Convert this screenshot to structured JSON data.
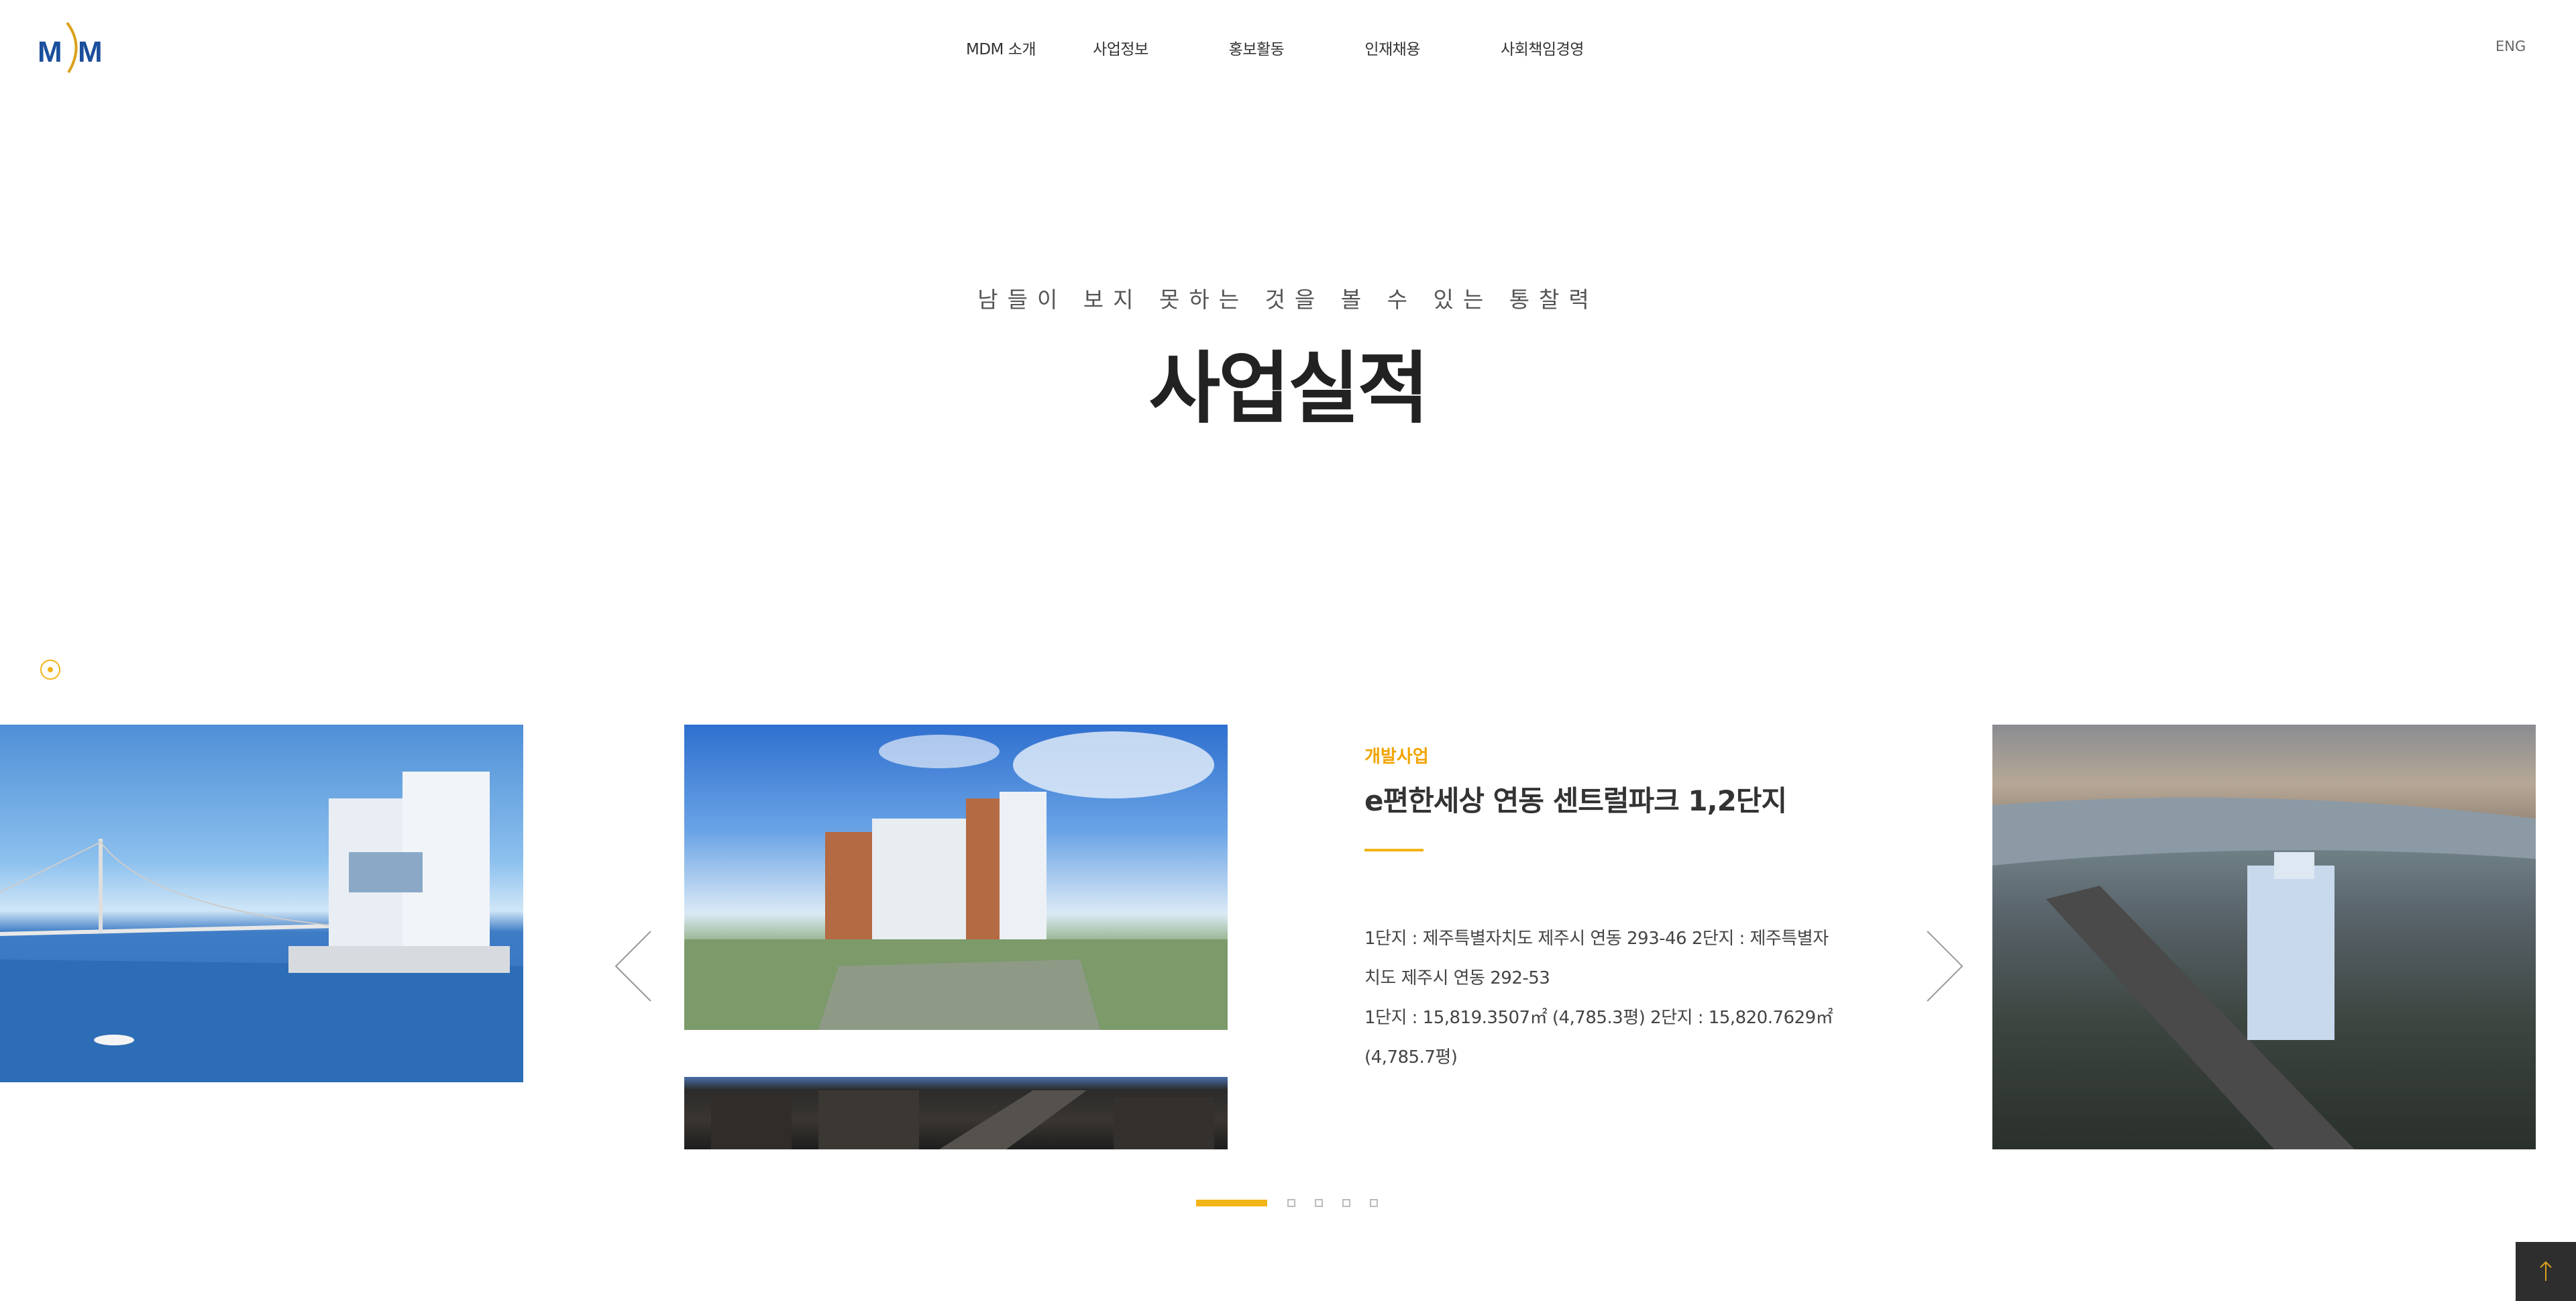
{
  "header": {
    "logo_text": "MDM",
    "nav": [
      "MDM 소개",
      "사업정보",
      "홍보활동",
      "인재채용",
      "사회책임경영"
    ],
    "lang": "ENG"
  },
  "hero": {
    "tagline": "남들이 보지 못하는 것을 볼 수 있는 통찰력",
    "title": "사업실적"
  },
  "slide": {
    "category": "개발사업",
    "title": "e편한세상 연동 센트럴파크 1,2단지",
    "lines": [
      "1단지 : 제주특별자치도 제주시 연동 293-46 2단지 : 제주특별자",
      "치도 제주시 연동 292-53",
      "1단지 : 15,819.3507㎡ (4,785.3평) 2단지 : 15,820.7629㎡",
      "(4,785.7평)"
    ]
  },
  "pagination": {
    "total": 5,
    "active": 1
  },
  "colors": {
    "accent": "#f2b417",
    "text": "#222222",
    "top_button": "#2e2e2e"
  },
  "icons": {
    "prev": "chevron-left-icon",
    "next": "chevron-right-icon",
    "top": "arrow-up-icon"
  }
}
